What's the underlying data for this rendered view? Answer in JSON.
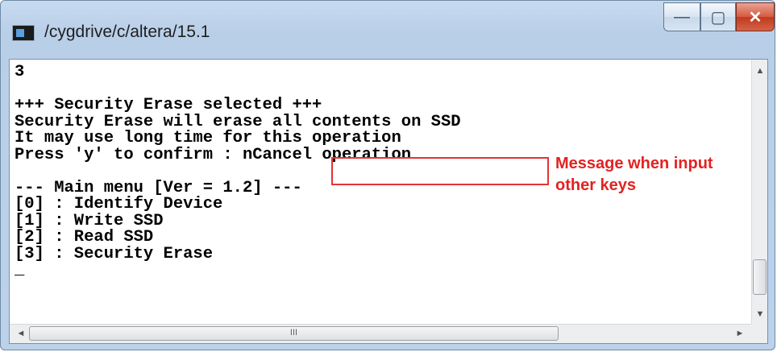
{
  "window": {
    "title": "/cygdrive/c/altera/15.1",
    "controls": {
      "minimize_icon": "—",
      "maximize_icon": "▢",
      "close_icon": "✕"
    }
  },
  "console": {
    "text": "3\n\n+++ Security Erase selected +++\nSecurity Erase will erase all contents on SSD\nIt may use long time for this operation\nPress 'y' to confirm : nCancel operation\n\n--- Main menu [Ver = 1.2] ---\n[0] : Identify Device\n[1] : Write SSD\n[2] : Read SSD\n[3] : Security Erase\n_"
  },
  "scrollbar": {
    "up_arrow": "▲",
    "down_arrow": "▼",
    "left_arrow": "◄",
    "right_arrow": "►",
    "hthumb_grip": "III"
  },
  "annotation": {
    "text": "Message when input\nother keys",
    "color": "#e32222"
  }
}
